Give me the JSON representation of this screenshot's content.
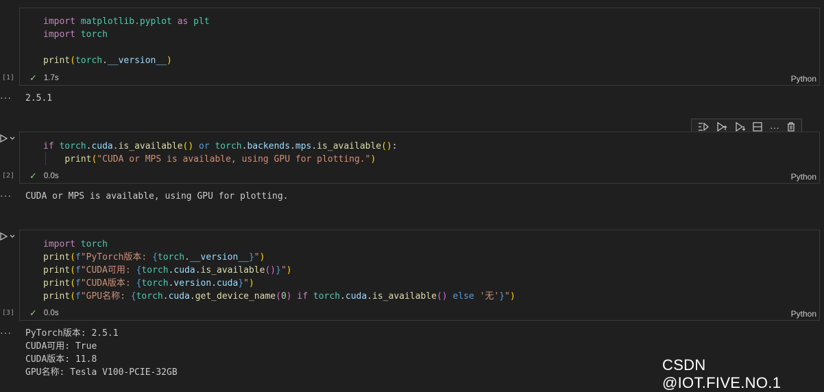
{
  "cells": [
    {
      "exec_count": "[1]",
      "duration": "1.7s",
      "language": "Python",
      "output": "2.5.1"
    },
    {
      "exec_count": "[2]",
      "duration": "0.0s",
      "language": "Python",
      "output": "CUDA or MPS is available, using GPU for plotting."
    },
    {
      "exec_count": "[3]",
      "duration": "0.0s",
      "language": "Python",
      "output": "PyTorch版本: 2.5.1\nCUDA可用: True\nCUDA版本: 11.8\nGPU名称: Tesla V100-PCIE-32GB"
    }
  ],
  "code_tokens": {
    "import": "import",
    "as": "as",
    "matplotlib_pyplot": "matplotlib.pyplot",
    "plt": "plt",
    "torch": "torch",
    "print": "print",
    "dunder_version": "__version__",
    "if": "if",
    "or": "or",
    "else": "else",
    "cuda": "cuda",
    "backends": "backends",
    "mps": "mps",
    "version": "version",
    "is_available": "is_available",
    "get_device_name": "get_device_name",
    "zero": "0",
    "str_cuda_mps": "\"CUDA or MPS is available, using GPU for plotting.\"",
    "f": "f",
    "str_pytorch": "\"PyTorch版本: ",
    "str_cuda_avail": "\"CUDA可用: ",
    "str_cuda_ver": "\"CUDA版本: ",
    "str_gpu": "\"GPU名称: ",
    "str_none": "'无'",
    "str_close": "\""
  },
  "toolbar": {
    "run_by_line_icon": "run-by-line-icon",
    "execute_above_icon": "execute-above-icon",
    "execute_below_icon": "execute-below-icon",
    "split_cell_icon": "split-cell-icon",
    "more_label": "···",
    "delete_icon": "trash-icon"
  },
  "output_ellipsis": "···",
  "watermark": "CSDN @IOT.FIVE.NO.1",
  "colors": {
    "background": "#1f1f1f",
    "check": "#89d185",
    "keyword": "#c586c0",
    "module": "#4ec9b0",
    "string": "#ce9178",
    "function": "#dcdcaa"
  }
}
